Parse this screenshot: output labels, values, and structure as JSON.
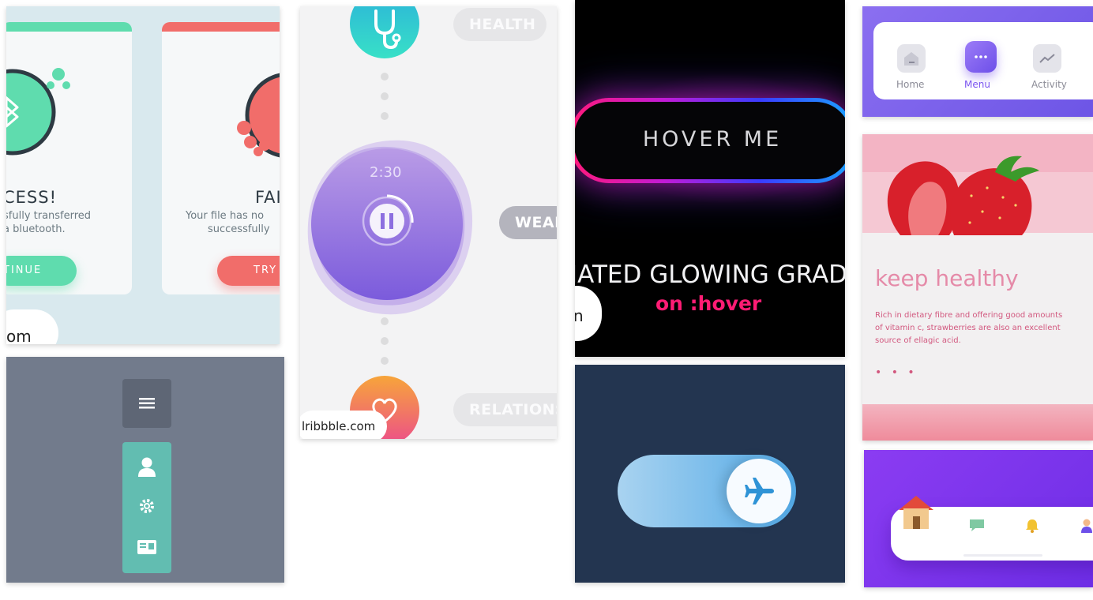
{
  "bluetooth": {
    "success_title": "CESS!",
    "success_line1": "sfully transferred",
    "success_line2": "a bluetooth.",
    "success_button": "TINUE",
    "fail_title": "FAI",
    "fail_line1": "Your file has no",
    "fail_line2": "successfully",
    "fail_button": "TRY",
    "source_label": "om",
    "colors": {
      "success": "#5fdcae",
      "fail": "#f16d6a"
    }
  },
  "meditation": {
    "timer": "2:30",
    "categories": [
      "HEALTH",
      "WEAL",
      "RELATIONS"
    ],
    "source_label": "lribbble.com",
    "icons": [
      "stethoscope-icon",
      "pause-icon",
      "heart-icon"
    ]
  },
  "glow": {
    "button_label": "HOVER ME",
    "caption_line1": "IATED GLOWING GRAD",
    "caption_line2": "on :hover",
    "source_label": "n",
    "colors": {
      "pink": "#ff1a7a",
      "blue": "#1aa4ff"
    }
  },
  "hamburger": {
    "icons": [
      "hamburger-icon",
      "user-icon",
      "gear-icon",
      "id-card-icon"
    ],
    "colors": {
      "menu": "#5e6675",
      "dropdown": "#62bdb1"
    }
  },
  "toggle": {
    "icon": "airplane-icon",
    "state": "on"
  },
  "tabbar": {
    "tabs": [
      {
        "label": "Home",
        "icon": "home-icon"
      },
      {
        "label": "Menu",
        "icon": "menu-dots-icon"
      },
      {
        "label": "Activity",
        "icon": "activity-icon"
      }
    ],
    "active_index": 1,
    "accent": "#7a54f0"
  },
  "strawberry": {
    "title": "keep healthy",
    "body_line1": "Rich in dietary fibre and offering good amounts",
    "body_line2": "of vitamin c, strawberries are also an excellent",
    "body_line3": "source of ellagic acid.",
    "dots": "• • •",
    "accent": "#e58aa8"
  },
  "purple_nav": {
    "icons": [
      "house-icon",
      "chat-icon",
      "bell-icon",
      "profile-icon"
    ]
  }
}
